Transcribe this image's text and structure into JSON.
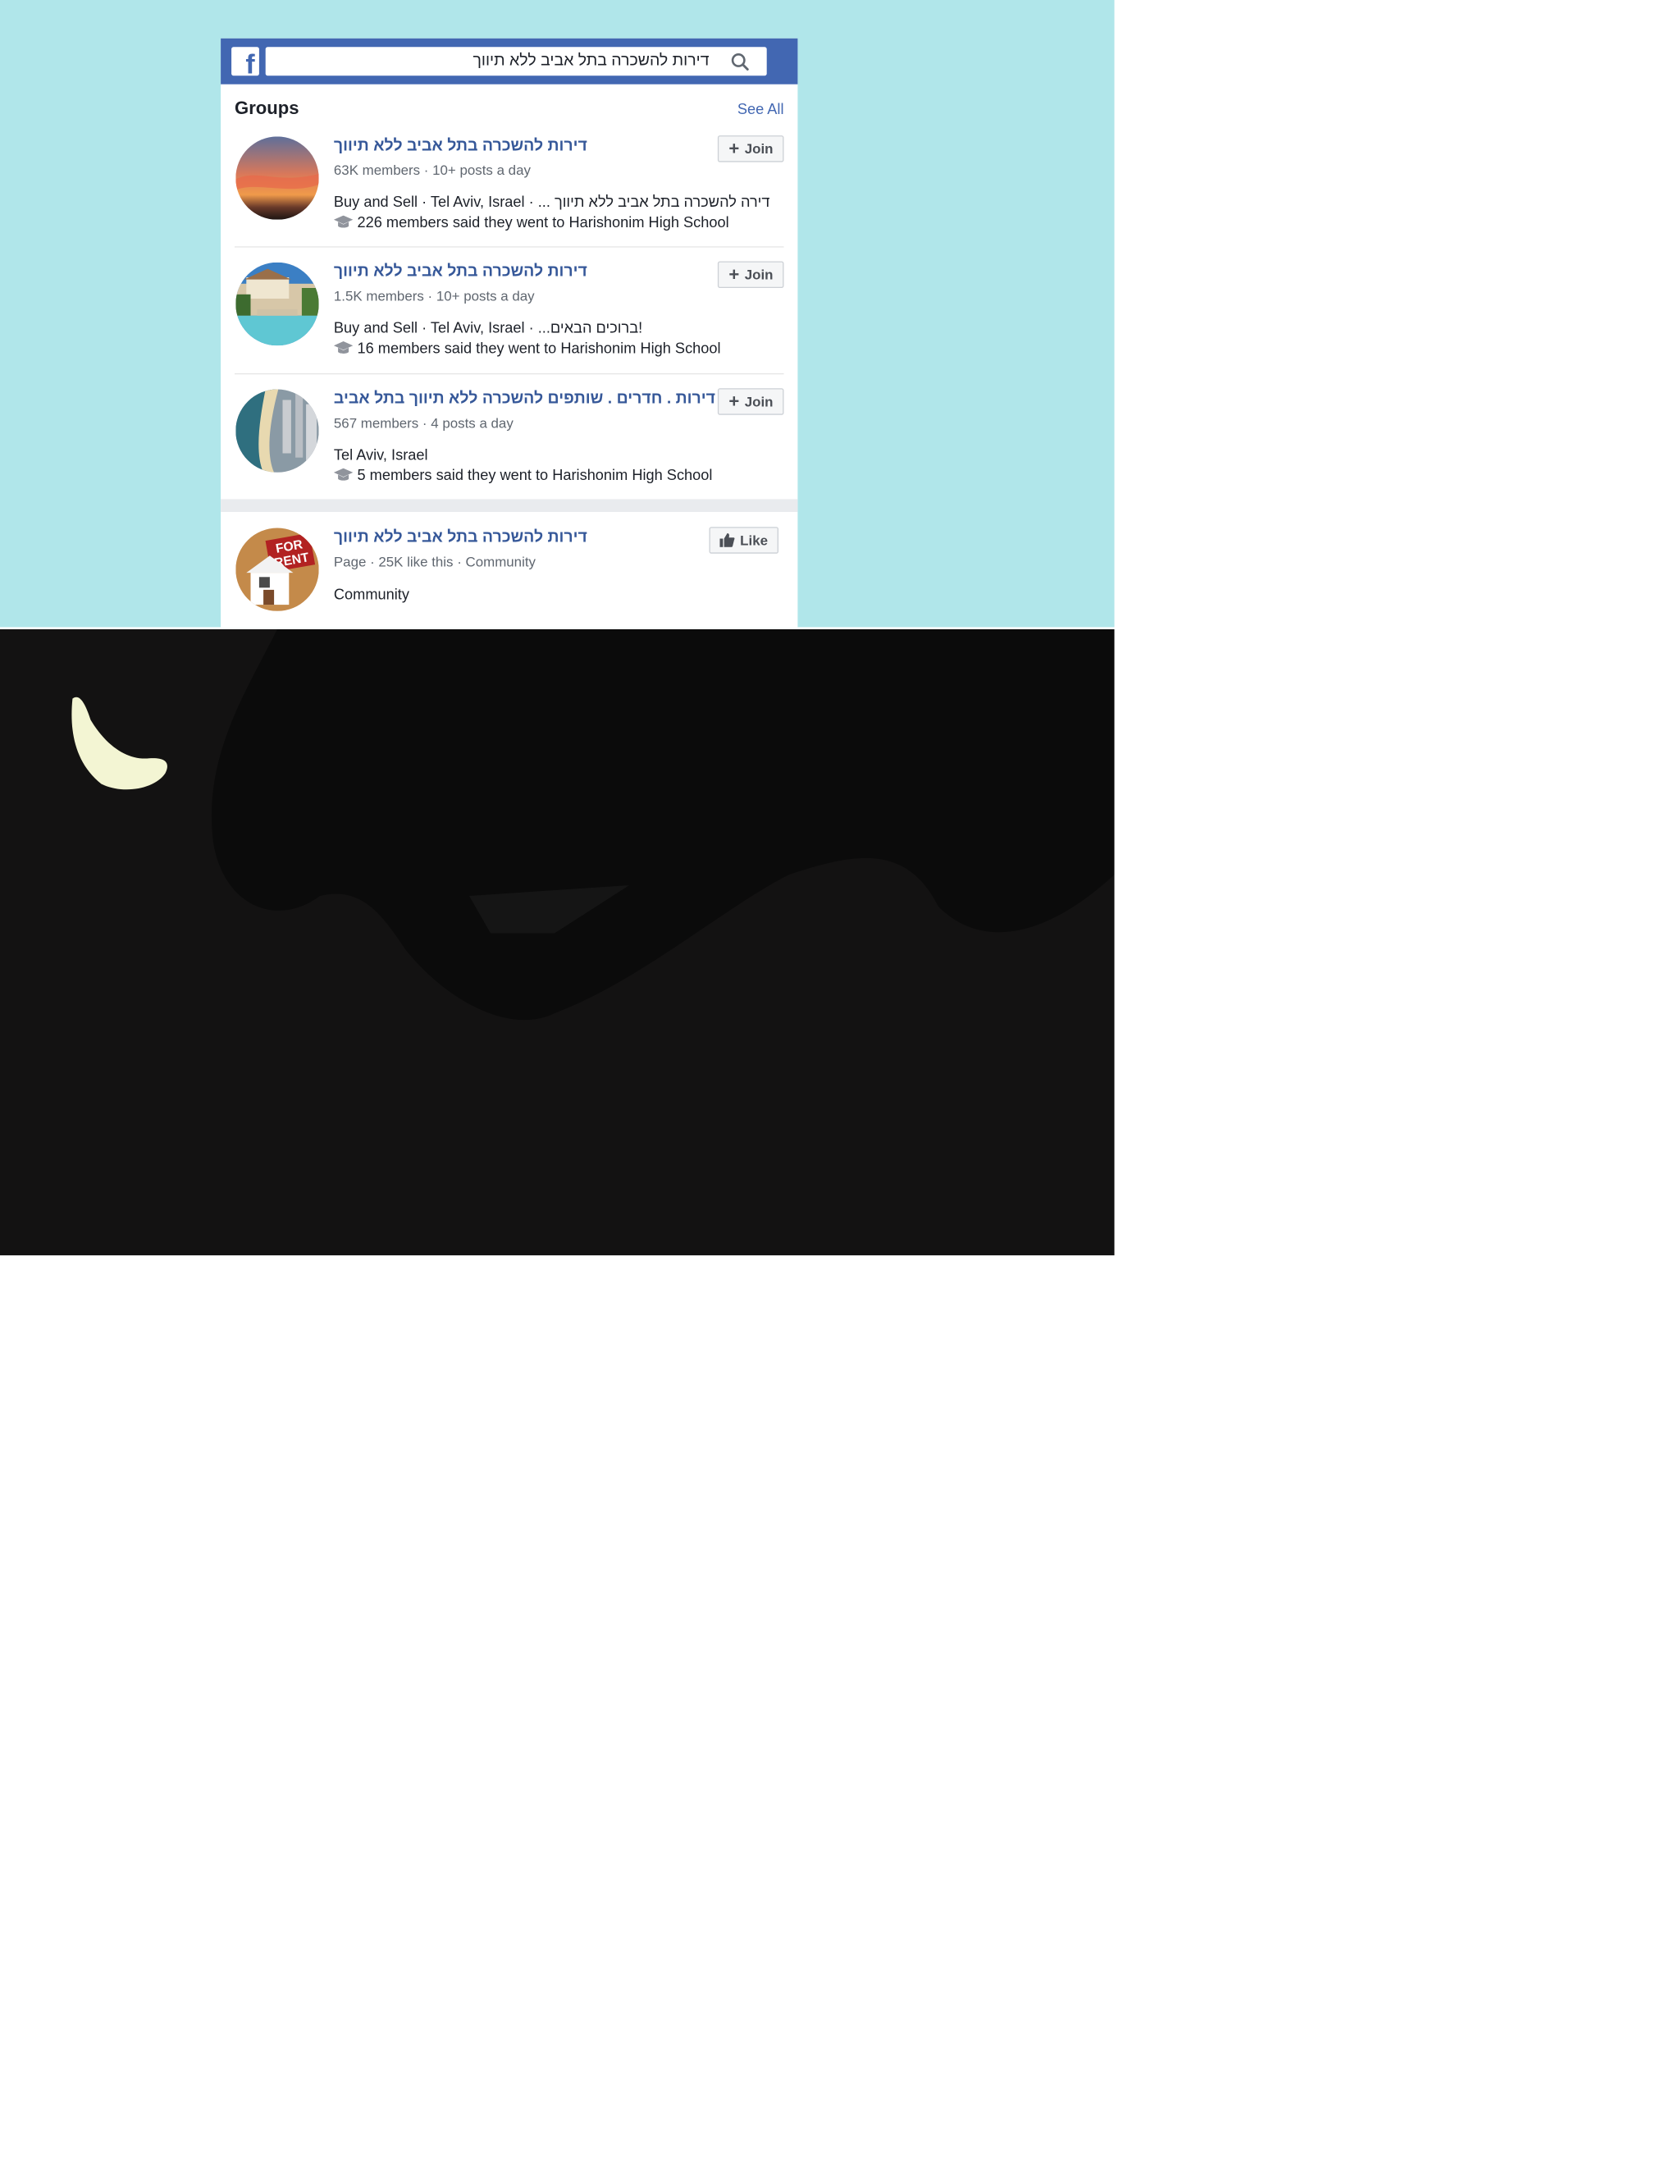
{
  "search": {
    "query": "דירות להשכרה בתל אביב ללא תיווך"
  },
  "header": {
    "logo": "f"
  },
  "groups_section": {
    "title": "Groups",
    "see_all": "See All"
  },
  "groups": [
    {
      "name": "דירות להשכרה בתל אביב ללא תיווך",
      "members": "63K members",
      "activity": "10+ posts a day",
      "description": "Buy and Sell · Tel Aviv, Israel · ... דירה להשכרה בתל אביב ללא תיווך",
      "school": "226 members said they went to Harishonim High School",
      "button": "Join"
    },
    {
      "name": "דירות להשכרה בתל אביב ללא תיווך",
      "members": "1.5K members",
      "activity": "10+ posts a day",
      "description": "Buy and Sell · Tel Aviv, Israel · ...ברוכים הבאים!",
      "school": "16 members said they went to Harishonim High School",
      "button": "Join"
    },
    {
      "name": "דירות . חדרים . שותפים להשכרה ללא תיווך בתל אביב",
      "members": "567 members",
      "activity": "4 posts a day",
      "description": "Tel Aviv, Israel",
      "school": "5 members said they went to Harishonim High School",
      "button": "Join"
    }
  ],
  "page_result": {
    "name": "דירות להשכרה בתל אביב ללא תיווך",
    "meta": "Page · 25K like this · Community",
    "category": "Community",
    "button": "Like",
    "avatar_sign": "FOR RENT"
  },
  "colors": {
    "top_bg": "#b0e6ea",
    "bottom_bg": "#131212",
    "facebook_blue": "#4267b2",
    "link_blue": "#365899"
  }
}
